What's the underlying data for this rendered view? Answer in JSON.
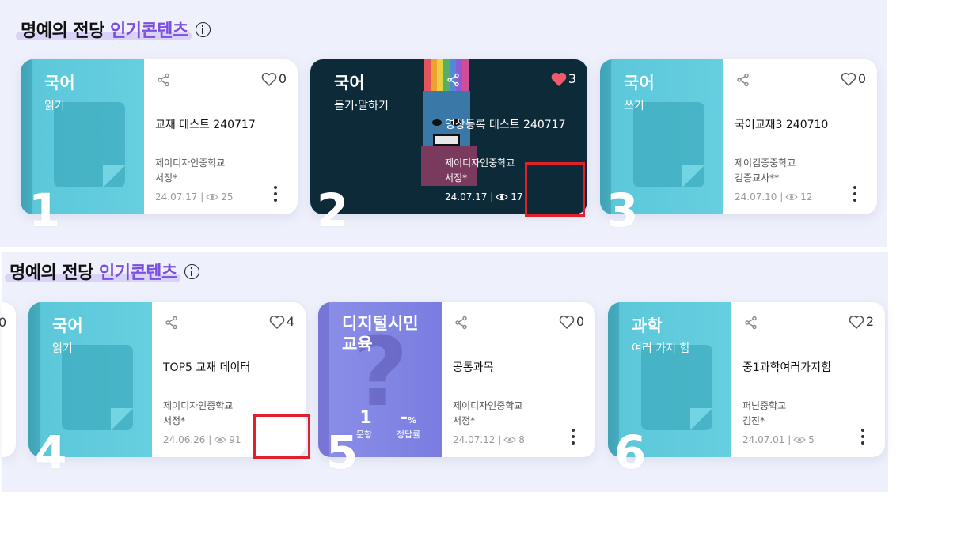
{
  "sections": [
    {
      "title_main": "명예의 전당",
      "title_accent": "인기콘텐츠"
    },
    {
      "title_main": "명예의 전당",
      "title_accent": "인기콘텐츠"
    }
  ],
  "colors": {
    "accent": "#7b4fe0",
    "teal": "#5cc8da",
    "dark": "#0d2a38",
    "purple": "#7a7de0",
    "heart_filled": "#f25a6a",
    "highlight_box": "#e0202a"
  },
  "cards": [
    {
      "rank": "1",
      "subject": "국어",
      "sub": "읽기",
      "title": "교재 테스트 240717",
      "school": "제이디자인중학교",
      "teacher": "서정*",
      "date": "24.07.17",
      "views": "25",
      "likes": "0",
      "liked": false
    },
    {
      "rank": "2",
      "subject": "국어",
      "sub": "듣기·말하기",
      "title": "영상등록 테스트 240717",
      "school": "제이디자인중학교",
      "teacher": "서정*",
      "date": "24.07.17",
      "views": "17",
      "likes": "3",
      "liked": true
    },
    {
      "rank": "3",
      "subject": "국어",
      "sub": "쓰기",
      "title": "국어교재3 240710",
      "school": "제이검증중학교",
      "teacher": "검증교사**",
      "date": "24.07.10",
      "views": "12",
      "likes": "0",
      "liked": false
    },
    {
      "rank": "4",
      "subject": "국어",
      "sub": "읽기",
      "title": "TOP5 교재 데이터",
      "school": "제이디자인중학교",
      "teacher": "서정*",
      "date": "24.06.26",
      "views": "91",
      "likes": "4",
      "liked": false
    },
    {
      "rank": "5",
      "subject": "디지털시민 교육",
      "sub": "",
      "title": "공통과목",
      "school": "제이디자인중학교",
      "teacher": "서정*",
      "date": "24.07.12",
      "views": "8",
      "likes": "0",
      "liked": false,
      "stat_count": "1",
      "stat_count_label": "문항",
      "stat_rate": "-",
      "stat_rate_unit": "%",
      "stat_rate_label": "정답률"
    },
    {
      "rank": "6",
      "subject": "과학",
      "sub": "여러 가지 힘",
      "title": "중1과학여러가지힘",
      "school": "퍼닌중학교",
      "teacher": "김진*",
      "date": "24.07.01",
      "views": "5",
      "likes": "2",
      "liked": false
    }
  ],
  "partial_prev_card": {
    "likes": "0"
  }
}
